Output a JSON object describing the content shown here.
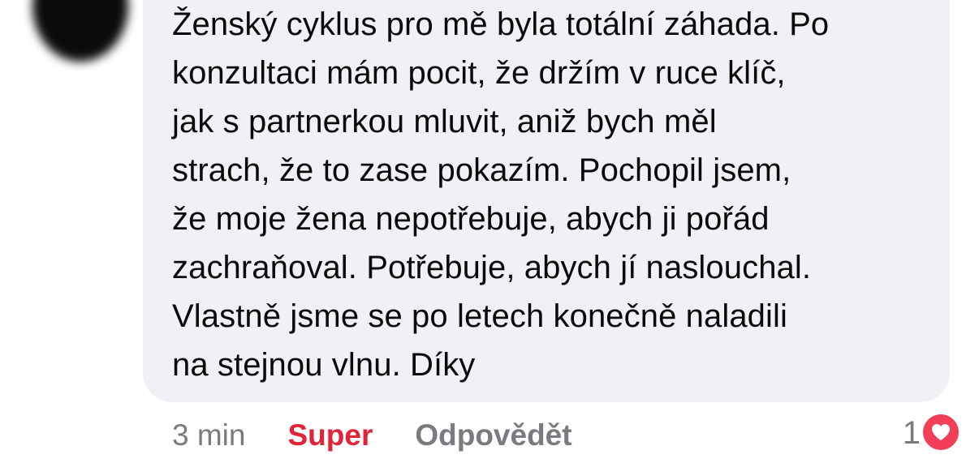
{
  "comment": {
    "lines": [
      "Ženský cyklus pro mě byla totální záhada. Po",
      "konzultaci mám pocit, že držím v ruce klíč,",
      "jak s partnerkou mluvit, aniž bych měl",
      "strach, že to zase pokazím. Pochopil jsem,",
      "že moje žena nepotřebuje, abych ji pořád",
      "zachraňoval. Potřebuje, abych jí naslouchal.",
      "Vlastně jsme se po letech konečně naladili",
      "na stejnou vlnu. Díky"
    ]
  },
  "meta": {
    "time": "3 min",
    "reaction_label": "Super",
    "reply_label": "Odpovědět"
  },
  "reactions": {
    "count": "1",
    "icon": "heart-icon"
  },
  "colors": {
    "bubble": "#f0f1f5",
    "text": "#0a0a0a",
    "muted": "#7a7b80",
    "reaction_red": "#e0243a",
    "heart": "#f23e56"
  }
}
